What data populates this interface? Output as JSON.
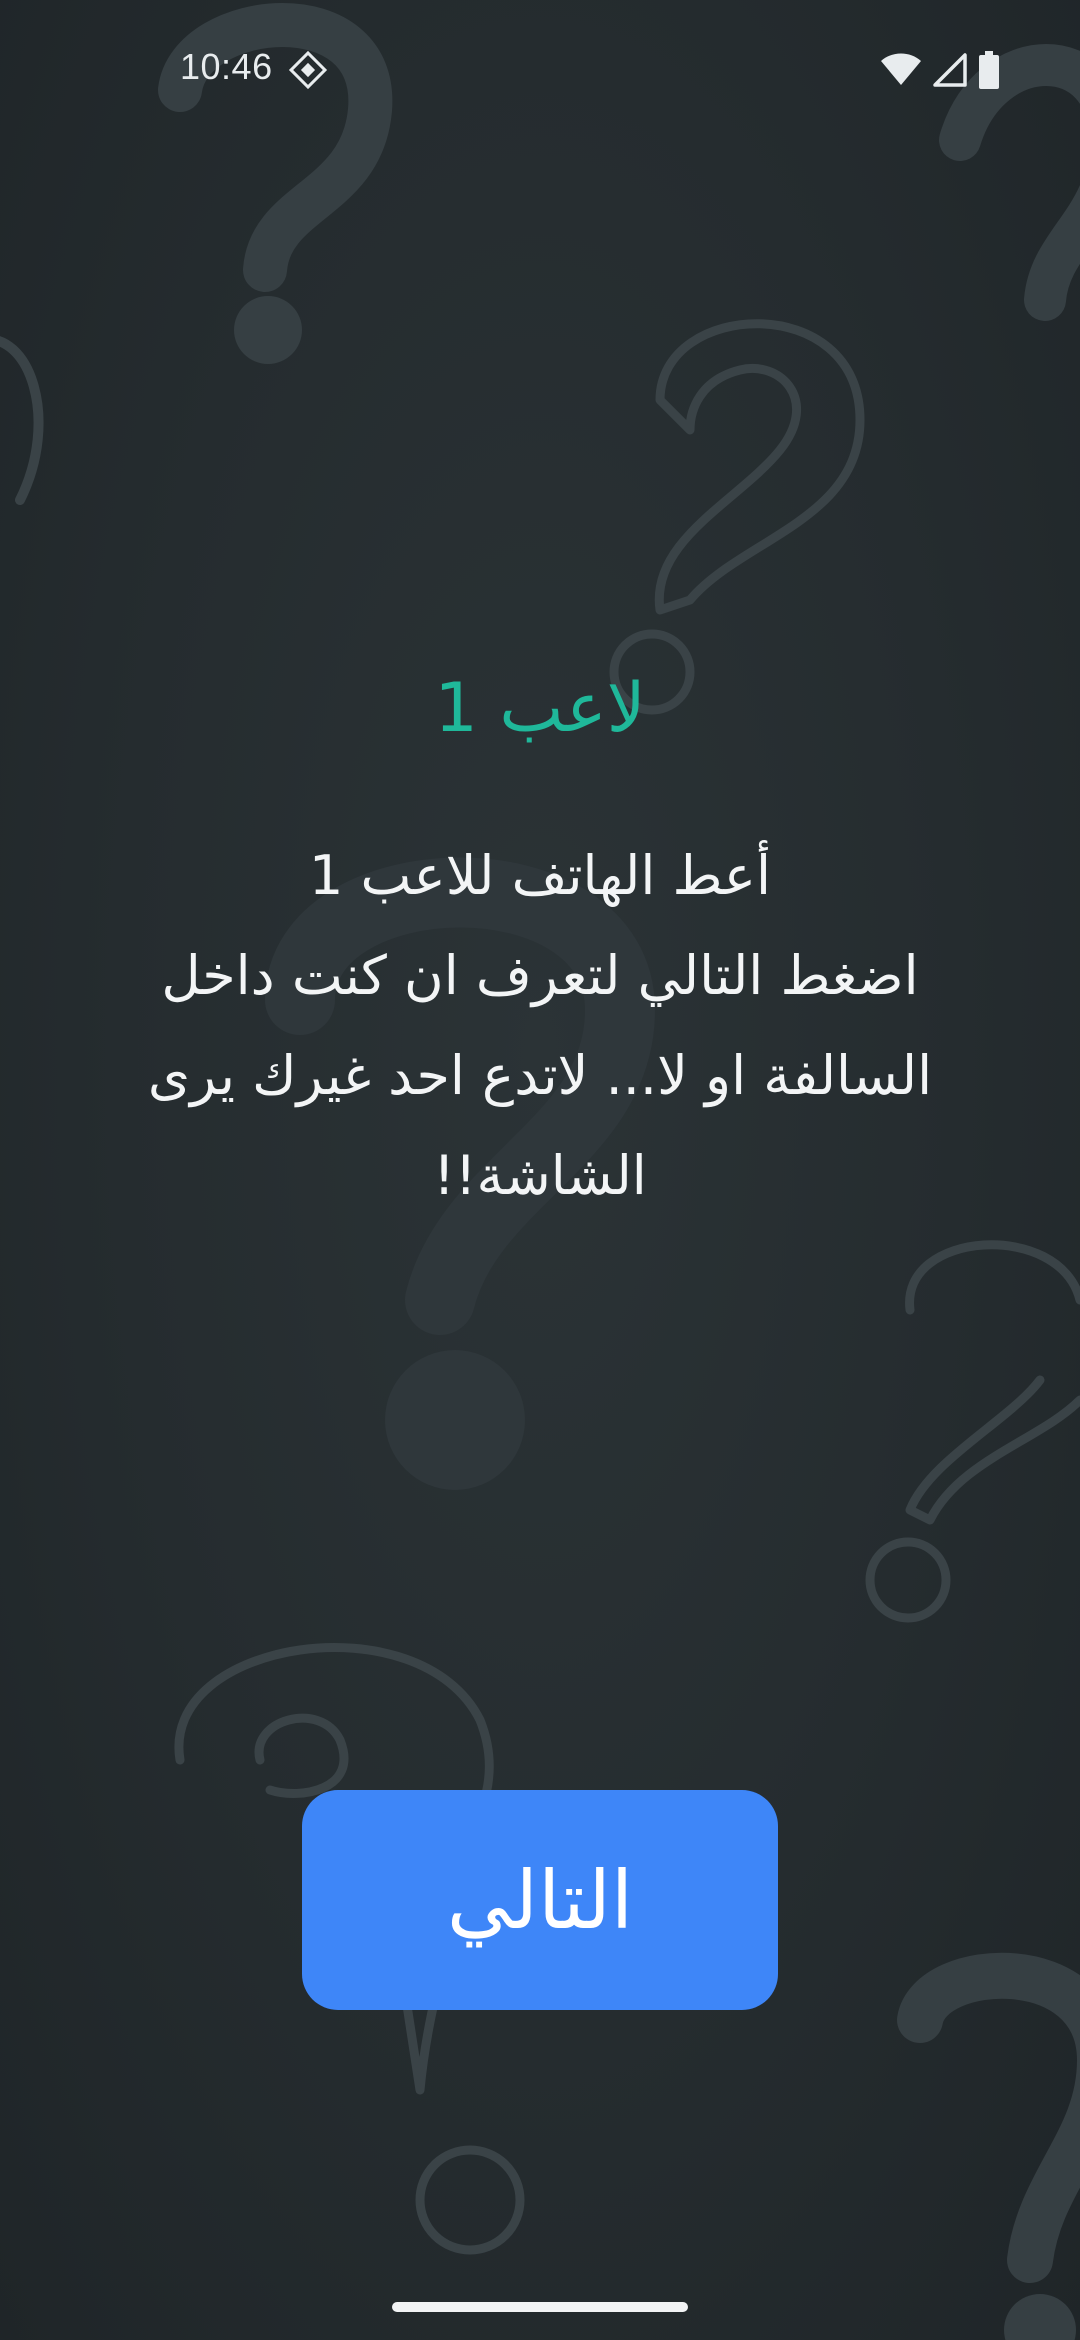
{
  "status_bar": {
    "time": "10:46",
    "icons": [
      "location-icon",
      "wifi-icon",
      "signal-icon",
      "battery-icon"
    ]
  },
  "content": {
    "player_title": "لاعب 1",
    "instructions": "أعط الهاتف للاعب 1\nاضغط التالي لتعرف ان كنت داخل السالفة او لا... لاتدع احد غيرك يرى الشاشة!!"
  },
  "actions": {
    "next_label": "التالي"
  },
  "colors": {
    "background": "#232a2d",
    "title_accent": "#1fb89a",
    "button": "#3e86f8",
    "text": "#f3f5f6"
  }
}
